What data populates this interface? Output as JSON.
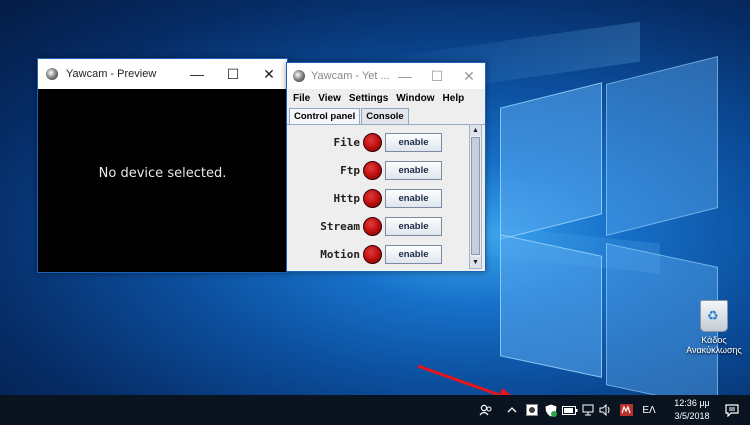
{
  "preview_window": {
    "title": "Yawcam - Preview",
    "minimize": "—",
    "maximize": "☐",
    "close": "✕",
    "message": "No device selected."
  },
  "main_window": {
    "title": "Yawcam - Yet ...",
    "minimize": "—",
    "maximize": "☐",
    "close": "✕",
    "menu": [
      "File",
      "View",
      "Settings",
      "Window",
      "Help"
    ],
    "tabs": [
      "Control panel",
      "Console"
    ],
    "rows": [
      {
        "label": "File",
        "button": "enable"
      },
      {
        "label": "Ftp",
        "button": "enable"
      },
      {
        "label": "Http",
        "button": "enable"
      },
      {
        "label": "Stream",
        "button": "enable"
      },
      {
        "label": "Motion",
        "button": "enable"
      }
    ]
  },
  "desktop": {
    "recycle_bin_label": "Κάδος Ανακύκλωσης"
  },
  "taskbar": {
    "language": "ΕΛ",
    "time": "12:36 μμ",
    "date": "3/5/2018"
  },
  "colors": {
    "taskbar": "#0a1421",
    "accent": "#1b63b8",
    "arrow": "#e8141c"
  }
}
